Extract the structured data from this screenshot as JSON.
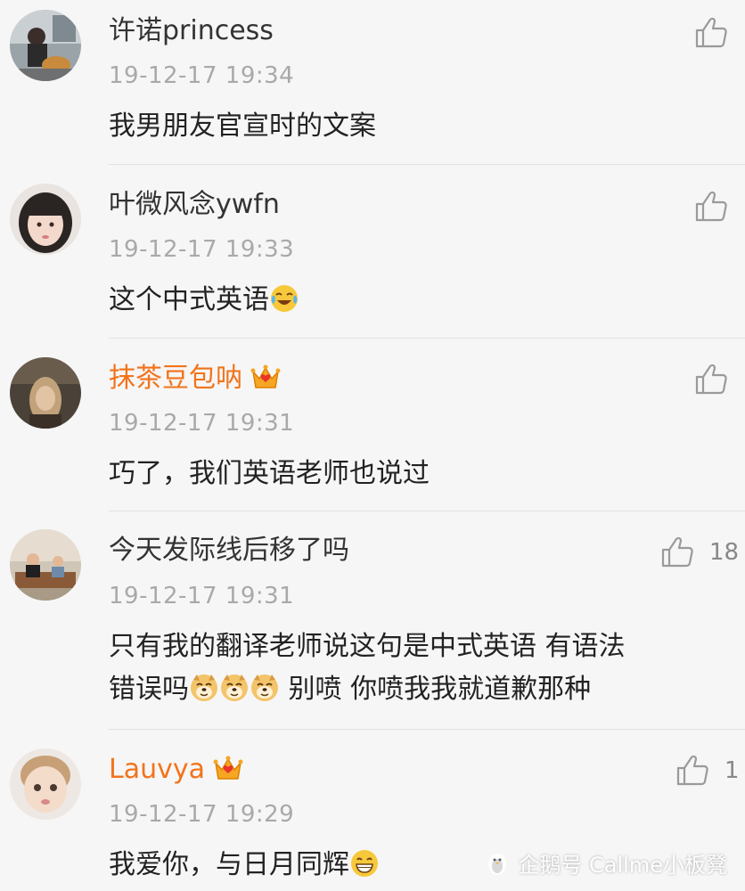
{
  "comments": [
    {
      "username": "许诺princess",
      "time": "19-12-17 19:34",
      "text": "我男朋友官宣时的文案",
      "likes": "",
      "vip": false
    },
    {
      "username": "叶微风念ywfn",
      "time": "19-12-17 19:33",
      "text": "这个中式英语",
      "likes": "",
      "vip": false
    },
    {
      "username": "抹茶豆包呐",
      "time": "19-12-17 19:31",
      "text": "巧了，我们英语老师也说过",
      "likes": "",
      "vip": true
    },
    {
      "username": "今天发际线后移了吗",
      "time": "19-12-17 19:31",
      "text_line1": "只有我的翻译老师说这句是中式英语 有语法",
      "text_line2_a": "错误吗",
      "text_line2_b": "别喷 你喷我我就道歉那种",
      "likes": "18",
      "vip": false
    },
    {
      "username": "Lauvya",
      "time": "19-12-17 19:29",
      "text": "我爱你，与日月同辉",
      "likes": "1",
      "vip": true
    }
  ],
  "watermark": {
    "text": "企鹅号 Callme小板凳",
    "icon": "penguin-icon"
  },
  "colors": {
    "vip_name": "#f2731b",
    "timestamp": "#a9a9a9",
    "background": "#f6f6f6",
    "divider": "#e2e2e2"
  }
}
